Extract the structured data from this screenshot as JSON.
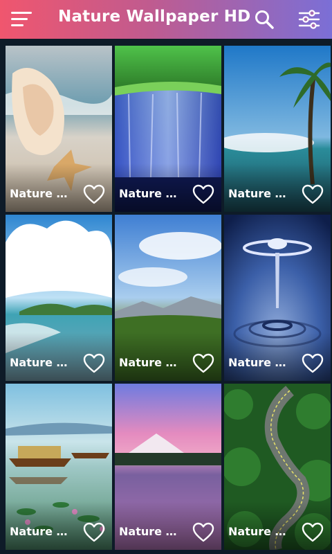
{
  "app": {
    "title": "Nature Wallpaper HD"
  },
  "toolbar": {
    "menu_icon": "hamburger-menu-icon",
    "search_icon": "search-icon",
    "filter_icon": "filter-sliders-icon"
  },
  "colors": {
    "topbar_start": "#f0566e",
    "topbar_end": "#7b6fd6",
    "background": "#0e1b28",
    "text": "#ffffff"
  },
  "wallpapers": [
    {
      "title": "Nature Wallpaper",
      "scene": "seashell-beach",
      "favorite_icon": "heart-outline-icon"
    },
    {
      "title": "Nature Wallpaper",
      "scene": "waterfall",
      "favorite_icon": "heart-outline-icon"
    },
    {
      "title": "Nature Wallpaper",
      "scene": "palm-beach",
      "favorite_icon": "heart-outline-icon"
    },
    {
      "title": "Nature Wallpaper",
      "scene": "island-clouds",
      "favorite_icon": "heart-outline-icon"
    },
    {
      "title": "Nature Wallpaper",
      "scene": "meadow-sky",
      "favorite_icon": "heart-outline-icon"
    },
    {
      "title": "Nature Wallpaper",
      "scene": "water-drop",
      "favorite_icon": "heart-outline-icon"
    },
    {
      "title": "Nature Wallpaper",
      "scene": "houseboat-lake",
      "favorite_icon": "heart-outline-icon"
    },
    {
      "title": "Nature Wallpaper",
      "scene": "mountain-lake",
      "favorite_icon": "heart-outline-icon"
    },
    {
      "title": "Nature Wallpaper",
      "scene": "forest-road",
      "favorite_icon": "heart-outline-icon"
    }
  ]
}
